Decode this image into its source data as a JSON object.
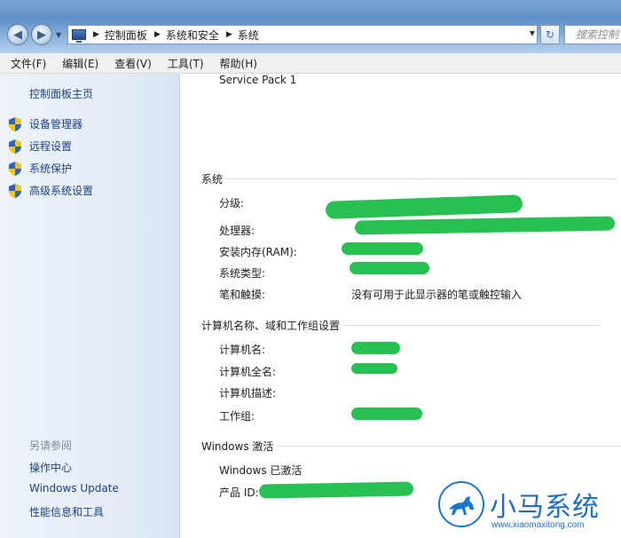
{
  "address_bar": {
    "crumbs": [
      "控制面板",
      "系统和安全",
      "系统"
    ],
    "search_placeholder": "搜索控制"
  },
  "menu": [
    "文件(F)",
    "编辑(E)",
    "查看(V)",
    "工具(T)",
    "帮助(H)"
  ],
  "left_pane": {
    "home_link": "控制面板主页",
    "tasks": [
      "设备管理器",
      "远程设置",
      "系统保护",
      "高级系统设置"
    ],
    "see_also_heading": "另请参阅",
    "see_also_links": [
      "操作中心",
      "Windows Update",
      "性能信息和工具"
    ]
  },
  "main": {
    "service_pack": "Service Pack 1",
    "system_section": {
      "heading": "系统",
      "rows": [
        {
          "label": "分级:"
        },
        {
          "label": "处理器:"
        },
        {
          "label": "安装内存(RAM):"
        },
        {
          "label": "系统类型:"
        },
        {
          "label": "笔和触摸:",
          "value": "没有可用于此显示器的笔或触控输入"
        }
      ]
    },
    "computer_section": {
      "heading": "计算机名称、域和工作组设置",
      "rows": [
        {
          "label": "计算机名:"
        },
        {
          "label": "计算机全名:"
        },
        {
          "label": "计算机描述:"
        },
        {
          "label": "工作组:"
        }
      ]
    },
    "activation_section": {
      "heading": "Windows 激活",
      "status": "Windows 已激活",
      "product_id_label": "产品 ID:"
    }
  },
  "watermark": {
    "brand": "小马系统",
    "url": "www.xiaomaxitong.com"
  },
  "colors": {
    "link": "#1b3f88",
    "redaction": "#1ebe4a",
    "watermark": "#1c6fc5"
  }
}
